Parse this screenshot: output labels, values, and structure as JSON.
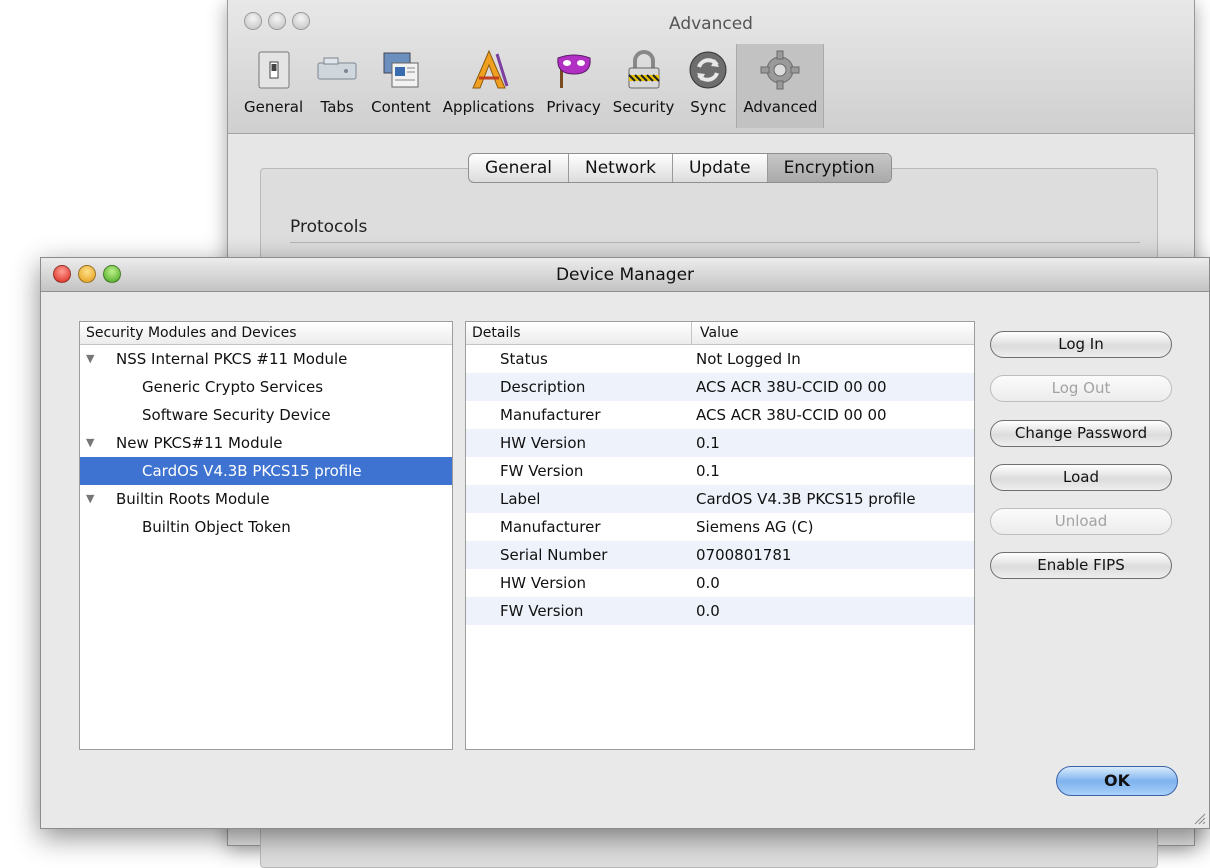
{
  "prefs_window": {
    "title": "Advanced",
    "toolbar": [
      {
        "label": "General",
        "icon": "general-switch-icon"
      },
      {
        "label": "Tabs",
        "icon": "tabs-icon"
      },
      {
        "label": "Content",
        "icon": "content-icon"
      },
      {
        "label": "Applications",
        "icon": "applications-icon"
      },
      {
        "label": "Privacy",
        "icon": "privacy-mask-icon"
      },
      {
        "label": "Security",
        "icon": "security-lock-icon"
      },
      {
        "label": "Sync",
        "icon": "sync-icon"
      },
      {
        "label": "Advanced",
        "icon": "advanced-gear-icon",
        "active": true
      }
    ],
    "subtabs": [
      "General",
      "Network",
      "Update",
      "Encryption"
    ],
    "active_subtab": "Encryption",
    "section_title": "Protocols"
  },
  "device_manager": {
    "title": "Device Manager",
    "tree_header": "Security Modules and Devices",
    "tree": [
      {
        "label": "NSS Internal PKCS #11 Module",
        "level": 0,
        "expanded": true
      },
      {
        "label": "Generic Crypto Services",
        "level": 1
      },
      {
        "label": "Software Security Device",
        "level": 1
      },
      {
        "label": "New PKCS#11 Module",
        "level": 0,
        "expanded": true
      },
      {
        "label": "CardOS V4.3B PKCS15 profile",
        "level": 1,
        "selected": true
      },
      {
        "label": "Builtin Roots Module",
        "level": 0,
        "expanded": true
      },
      {
        "label": "Builtin Object Token",
        "level": 1
      }
    ],
    "details_header": {
      "details": "Details",
      "value": "Value"
    },
    "details": [
      {
        "key": "Status",
        "value": "Not Logged In"
      },
      {
        "key": "Description",
        "value": "ACS ACR 38U-CCID 00 00"
      },
      {
        "key": "Manufacturer",
        "value": "ACS ACR 38U-CCID 00 00"
      },
      {
        "key": "HW Version",
        "value": "0.1"
      },
      {
        "key": "FW Version",
        "value": "0.1"
      },
      {
        "key": "Label",
        "value": "CardOS V4.3B PKCS15 profile"
      },
      {
        "key": "Manufacturer",
        "value": "Siemens AG (C)"
      },
      {
        "key": "Serial Number",
        "value": "0700801781"
      },
      {
        "key": "HW Version",
        "value": "0.0"
      },
      {
        "key": "FW Version",
        "value": "0.0"
      }
    ],
    "buttons": {
      "log_in": "Log In",
      "log_out": "Log Out",
      "change_password": "Change Password",
      "load": "Load",
      "unload": "Unload",
      "enable_fips": "Enable FIPS",
      "ok": "OK"
    },
    "colors": {
      "selection": "#3f73d1",
      "ok_button": "#7fb3ee"
    }
  }
}
